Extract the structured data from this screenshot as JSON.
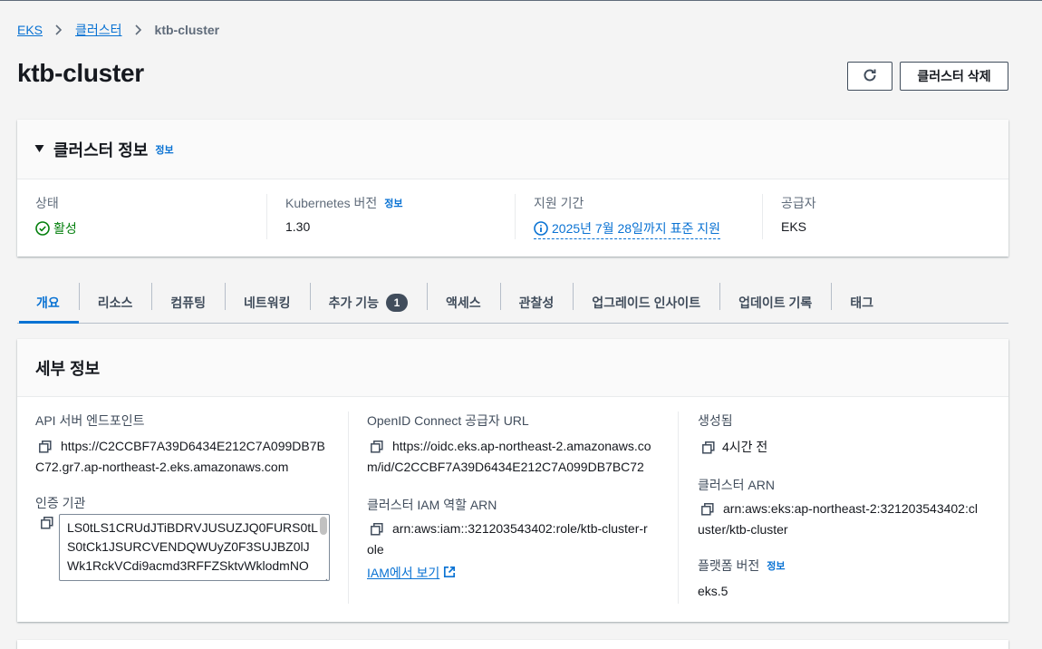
{
  "breadcrumb": {
    "root": "EKS",
    "parent": "클러스터",
    "current": "ktb-cluster"
  },
  "page": {
    "title": "ktb-cluster",
    "delete_label": "클러스터 삭제"
  },
  "cluster_info": {
    "title": "클러스터 정보",
    "info": "정보",
    "status": {
      "label": "상태",
      "value": "활성"
    },
    "k8s": {
      "label": "Kubernetes 버전",
      "info": "정보",
      "value": "1.30"
    },
    "support": {
      "label": "지원 기간",
      "value": "2025년 7월 28일까지 표준 지원"
    },
    "provider": {
      "label": "공급자",
      "value": "EKS"
    }
  },
  "tabs": [
    {
      "label": "개요"
    },
    {
      "label": "리소스"
    },
    {
      "label": "컴퓨팅"
    },
    {
      "label": "네트워킹"
    },
    {
      "label": "추가 기능",
      "badge": "1"
    },
    {
      "label": "액세스"
    },
    {
      "label": "관찰성"
    },
    {
      "label": "업그레이드 인사이트"
    },
    {
      "label": "업데이트 기록"
    },
    {
      "label": "태그"
    }
  ],
  "details": {
    "title": "세부 정보",
    "api_endpoint": {
      "label": "API 서버 엔드포인트",
      "line1": "https://C2CCBF7A39D6434E212C7A099DB7B",
      "line2": "C72.gr7.ap-northeast-2.eks.amazonaws.com"
    },
    "cert_authority": {
      "label": "인증 기관",
      "line1": "LS0tLS1CRUdJTiBDRVJUSUZJQ0FURS0tL",
      "line2": "S0tCk1JSURCVENDQWUyZ0F3SUJBZ0lJ",
      "line3": "Wk1RckVCdi9acmd3RFFZSktvWklodmNO"
    },
    "oidc": {
      "label": "OpenID Connect 공급자 URL",
      "line1": "https://oidc.eks.ap-northeast-2.amazonaws.co",
      "line2": "m/id/C2CCBF7A39D6434E212C7A099DB7BC72"
    },
    "iam_role": {
      "label": "클러스터 IAM 역할 ARN",
      "line1": "arn:aws:iam::321203543402:role/ktb-cluster-r",
      "line2": "ole",
      "link": "IAM에서 보기"
    },
    "created": {
      "label": "생성됨",
      "value": "4시간 전"
    },
    "cluster_arn": {
      "label": "클러스터 ARN",
      "line1": "arn:aws:eks:ap-northeast-2:321203543402:cl",
      "line2": "uster/ktb-cluster"
    },
    "platform": {
      "label": "플랫폼 버전",
      "info": "정보",
      "value": "eks.5"
    }
  },
  "colors": {
    "accent": "#0972d3",
    "success": "#037f0c",
    "text": "#16191f"
  }
}
